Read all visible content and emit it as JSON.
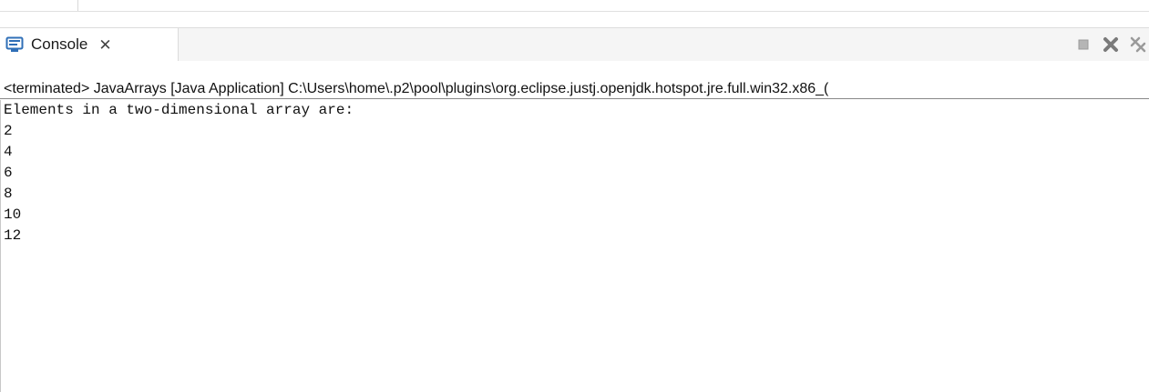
{
  "console_tab": {
    "label": "Console",
    "icon": "console-icon",
    "close_icon": "close-icon"
  },
  "toolbar": {
    "icons": [
      "terminate-icon",
      "remove-launch-icon",
      "remove-all-terminated-icon"
    ]
  },
  "status_line": "<terminated> JavaArrays [Java Application] C:\\Users\\home\\.p2\\pool\\plugins\\org.eclipse.justj.openjdk.hotspot.jre.full.win32.x86_(",
  "console_output": [
    "Elements in a two-dimensional array are:",
    "2",
    "4",
    "6",
    "8",
    "10",
    "12"
  ],
  "colors": {
    "console_icon_blue": "#2f6fb7",
    "toolbar_red": "#c23b22",
    "disabled_gray": "#9a9a9a"
  }
}
